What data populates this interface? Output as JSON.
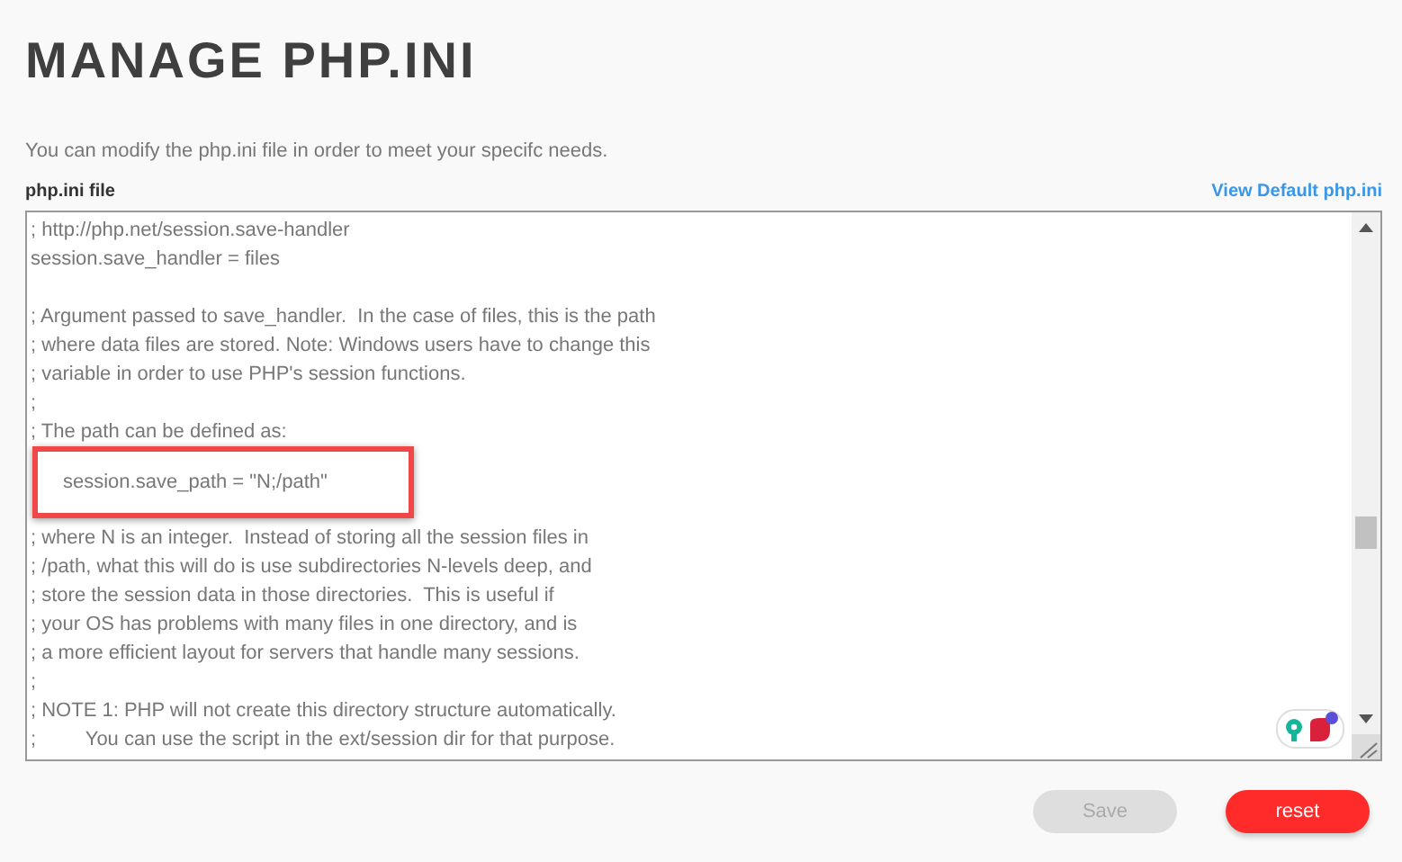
{
  "page": {
    "title": "MANAGE PHP.INI",
    "description": "You can modify the php.ini file in order to meet your specifc needs."
  },
  "editor": {
    "label": "php.ini file",
    "link": "View Default php.ini",
    "lines": [
      {
        "kind": "text",
        "text": "; http://php.net/session.save-handler"
      },
      {
        "kind": "text",
        "text": "session.save_handler = files"
      },
      {
        "kind": "blank"
      },
      {
        "kind": "text",
        "text": "; Argument passed to save_handler.  In the case of files, this is the path"
      },
      {
        "kind": "text",
        "text": "; where data files are stored. Note: Windows users have to change this"
      },
      {
        "kind": "text",
        "text": "; variable in order to use PHP's session functions."
      },
      {
        "kind": "text",
        "text": ";"
      },
      {
        "kind": "text",
        "text": "; The path can be defined as:"
      },
      {
        "kind": "highlighted",
        "text": "session.save_path = \"N;/path\""
      },
      {
        "kind": "text",
        "text": "; where N is an integer.  Instead of storing all the session files in"
      },
      {
        "kind": "text",
        "text": "; /path, what this will do is use subdirectories N-levels deep, and"
      },
      {
        "kind": "text",
        "text": "; store the session data in those directories.  This is useful if"
      },
      {
        "kind": "text",
        "text": "; your OS has problems with many files in one directory, and is"
      },
      {
        "kind": "text",
        "text": "; a more efficient layout for servers that handle many sessions."
      },
      {
        "kind": "text",
        "text": ";"
      },
      {
        "kind": "text",
        "text": "; NOTE 1: PHP will not create this directory structure automatically."
      },
      {
        "kind": "text",
        "text": ";         You can use the script in the ext/session dir for that purpose."
      }
    ]
  },
  "buttons": [
    {
      "label": "Save",
      "kind": "secondary",
      "disabled": true
    },
    {
      "label": "reset",
      "kind": "danger",
      "disabled": false
    }
  ]
}
